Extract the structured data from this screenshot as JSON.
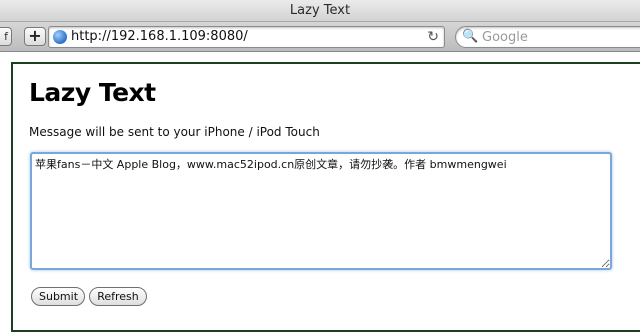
{
  "window": {
    "title": "Lazy Text"
  },
  "toolbar": {
    "nav_stub_glyph": "f",
    "add_glyph": "+",
    "url": "http://192.168.1.109:8080/",
    "reload_glyph": "↻",
    "search_placeholder": "Google",
    "search_glyph": "🔍"
  },
  "page": {
    "title": "Lazy Text",
    "subtitle": "Message will be sent to your iPhone / iPod Touch",
    "message": "苹果fans－中文 Apple Blog，www.mac52ipod.cn原创文章，请勿抄袭。作者 bmwmengwei",
    "submit_label": "Submit",
    "refresh_label": "Refresh"
  }
}
